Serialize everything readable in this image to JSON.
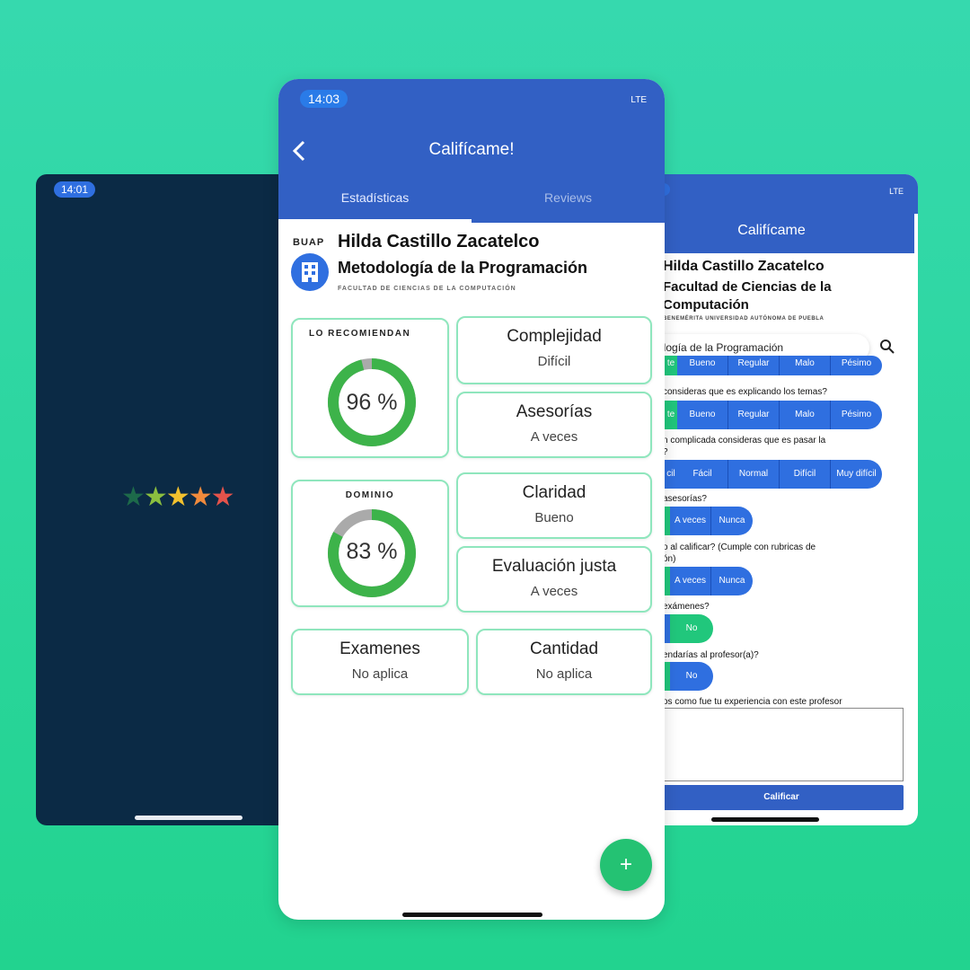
{
  "left_screen": {
    "time": "14:01",
    "stars": [
      "★",
      "★",
      "★",
      "★",
      "★"
    ],
    "star_colors": [
      "#1d6a4a",
      "#8bbf3f",
      "#f2c12e",
      "#f08a3c",
      "#e5534b"
    ]
  },
  "center_screen": {
    "time": "14:03",
    "status_indicators": "LTE",
    "title": "Califícame!",
    "back_icon": "chevron-left-icon",
    "tabs": [
      "Estadísticas",
      "Reviews"
    ],
    "logo_text": "BUAP",
    "professor": "Hilda Castillo Zacatelco",
    "subject": "Metodología de la Programación",
    "faculty": "FACULTAD DE CIENCIAS DE LA COMPUTACIÓN",
    "recommend": {
      "label": "LO RECOMIENDAN",
      "value": "96 %",
      "percent": 0.96
    },
    "domain": {
      "label": "DOMINIO",
      "value": "83 %",
      "percent": 0.83
    },
    "stats": [
      {
        "title": "Complejidad",
        "value": "Difícil"
      },
      {
        "title": "Asesorías",
        "value": "A veces"
      },
      {
        "title": "Claridad",
        "value": "Bueno"
      },
      {
        "title": "Evaluación justa",
        "value": "A veces"
      },
      {
        "title": "Examenes",
        "value": "No aplica"
      },
      {
        "title": "Cantidad",
        "value": "No aplica"
      }
    ],
    "fab_label": "+",
    "accent": "#3260c4",
    "green": "#3db34a"
  },
  "right_screen": {
    "status_indicators": "LTE",
    "title": "Califícame",
    "professor": "Hilda Castillo Zacatelco",
    "faculty": "Facultad de Ciencias de la Computación",
    "university": "BENEMÉRITA UNIVERSIDAD AUTÓNOMA DE PUEBLA",
    "search_value": "ología de la Programación",
    "seg_row_1": [
      "te",
      "Bueno",
      "Regular",
      "Malo",
      "Pésimo"
    ],
    "q2": "consideras que es explicando los temas?",
    "seg_row_2": [
      "te",
      "Bueno",
      "Regular",
      "Malo",
      "Pésimo"
    ],
    "q3a": "n complicada consideras que es pasar la",
    "q3b": "?",
    "seg_row_3": [
      "cil",
      "Fácil",
      "Normal",
      "Difícil",
      "Muy difícil"
    ],
    "q4": "asesorías?",
    "seg_row_4": [
      "",
      "A veces",
      "Nunca"
    ],
    "q5a": "o al calificar? (Cumple con rubricas de",
    "q5b": "ón)",
    "seg_row_5": [
      "",
      "A veces",
      "Nunca"
    ],
    "q6": "exámenes?",
    "seg_row_6": [
      "",
      "No"
    ],
    "q7": "endarías al profesor(a)?",
    "seg_row_7": [
      "",
      "No"
    ],
    "q8": "os como fue tu experiencia con este profesor",
    "submit": "Calificar"
  }
}
